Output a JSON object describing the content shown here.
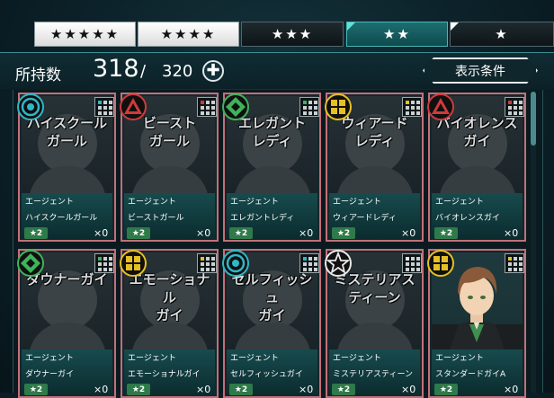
{
  "tabs": [
    {
      "label": "★★★★★",
      "active": false
    },
    {
      "label": "★★★★",
      "active": false
    },
    {
      "label": "★★★",
      "active": false
    },
    {
      "label": "★★",
      "active": true
    },
    {
      "label": "★",
      "active": false
    }
  ],
  "header": {
    "count_label": "所持数",
    "count_value": "318",
    "count_sep": "/",
    "count_max": "320",
    "add_symbol": "✚",
    "filter_label": "表示条件"
  },
  "cards": [
    {
      "display_name": "ハイスクール\nガール",
      "role": "エージェント",
      "name": "ハイスクールガール",
      "rank": "★2",
      "qty": "×0",
      "emblem": "cyan-circle-emblem",
      "accent": "#2fb7c8",
      "has_portrait": false
    },
    {
      "display_name": "ビースト\nガール",
      "role": "エージェント",
      "name": "ビーストガール",
      "rank": "★2",
      "qty": "×0",
      "emblem": "red-triangle-emblem",
      "accent": "#d23a3a",
      "has_portrait": false
    },
    {
      "display_name": "エレガント\nレディ",
      "role": "エージェント",
      "name": "エレガントレディ",
      "rank": "★2",
      "qty": "×0",
      "emblem": "green-diamond-emblem",
      "accent": "#3fb35a",
      "has_portrait": false
    },
    {
      "display_name": "ウィアード\nレディ",
      "role": "エージェント",
      "name": "ウィアードレディ",
      "rank": "★2",
      "qty": "×0",
      "emblem": "yellow-square-emblem",
      "accent": "#e6c022",
      "has_portrait": false
    },
    {
      "display_name": "バイオレンス\nガイ",
      "role": "エージェント",
      "name": "バイオレンスガイ",
      "rank": "★2",
      "qty": "×0",
      "emblem": "red-triangle-emblem",
      "accent": "#d23a3a",
      "has_portrait": false
    },
    {
      "display_name": "ダウナーガイ",
      "role": "エージェント",
      "name": "ダウナーガイ",
      "rank": "★2",
      "qty": "×0",
      "emblem": "green-diamond-emblem",
      "accent": "#3fb35a",
      "has_portrait": false
    },
    {
      "display_name": "エモーショナル\nガイ",
      "role": "エージェント",
      "name": "エモーショナルガイ",
      "rank": "★2",
      "qty": "×0",
      "emblem": "yellow-square-emblem",
      "accent": "#e6c022",
      "has_portrait": false
    },
    {
      "display_name": "セルフィッシュ\nガイ",
      "role": "エージェント",
      "name": "セルフィッシュガイ",
      "rank": "★2",
      "qty": "×0",
      "emblem": "cyan-circle-emblem",
      "accent": "#2fb7c8",
      "has_portrait": false
    },
    {
      "display_name": "ミステリアス\nティーン",
      "role": "エージェント",
      "name": "ミステリアスティーン",
      "rank": "★2",
      "qty": "×0",
      "emblem": "white-star-emblem",
      "accent": "#e8e8e8",
      "has_portrait": false
    },
    {
      "display_name": "",
      "role": "エージェント",
      "name": "スタンダードガイA",
      "rank": "★2",
      "qty": "×0",
      "emblem": "yellow-square-emblem",
      "accent": "#e6c022",
      "has_portrait": true
    }
  ]
}
